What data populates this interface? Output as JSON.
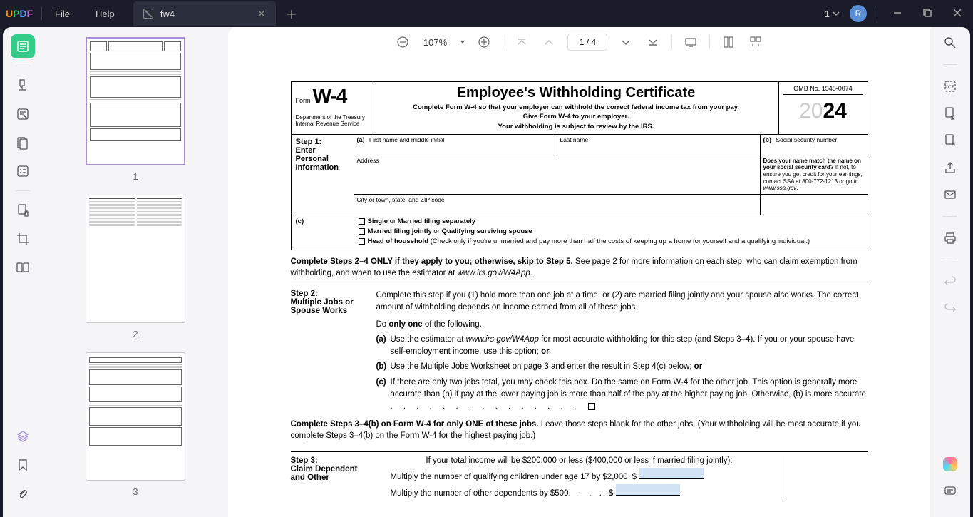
{
  "app": {
    "logo_chars": [
      "U",
      "P",
      "D",
      "F"
    ],
    "menu": {
      "file": "File",
      "help": "Help"
    },
    "tab_title": "fw4",
    "version": "1",
    "avatar_initial": "R"
  },
  "toolbar": {
    "zoom": "107%",
    "page_indicator": "1 / 4"
  },
  "thumbnails": {
    "pages": [
      "1",
      "2",
      "3"
    ]
  },
  "form": {
    "header": {
      "form_label": "Form",
      "form_code": "W-4",
      "dept1": "Department of the Treasury",
      "dept2": "Internal Revenue Service",
      "title": "Employee's Withholding Certificate",
      "sub1": "Complete Form W-4 so that your employer can withhold the correct federal income tax from your pay.",
      "sub2": "Give Form W-4 to your employer.",
      "sub3": "Your withholding is subject to review by the IRS.",
      "omb": "OMB No. 1545-0074",
      "year_prefix": "20",
      "year_suffix": "24"
    },
    "step1": {
      "label": "Step 1:",
      "title": "Enter Personal Information",
      "a_label": "(a)",
      "first_name": "First name and middle initial",
      "last_name": "Last name",
      "b_label": "(b)",
      "ssn": "Social security number",
      "address": "Address",
      "city": "City or town, state, and ZIP code",
      "name_match": "Does your name match the name on your social security card? If not, to ensure you get credit for your earnings, contact SSA at 800-772-1213 or go to www.ssa.gov.",
      "c_label": "(c)",
      "filing_single": "Single or Married filing separately",
      "filing_joint": "Married filing jointly or Qualifying surviving spouse",
      "filing_hoh": "Head of household (Check only if you're unmarried and pay more than half the costs of keeping up a home for yourself and a qualifying individual.)"
    },
    "instructions": {
      "complete24_bold": "Complete Steps 2–4 ONLY if they apply to you; otherwise, skip to Step 5.",
      "complete24_rest": " See page 2 for more information on each step, who can claim exemption from withholding, and when to use the estimator at ",
      "w4app": "www.irs.gov/W4App",
      "step34_bold": "Complete Steps 3–4(b) on Form W-4 for only ONE of these jobs.",
      "step34_rest": " Leave those steps blank for the other jobs. (Your withholding will be most accurate if you complete Steps 3–4(b) on the Form W-4 for the highest paying job.)"
    },
    "step2": {
      "label": "Step 2:",
      "title": "Multiple Jobs or Spouse Works",
      "intro": "Complete this step if you (1) hold more than one job at a time, or (2) are married filing jointly and your spouse also works. The correct amount of withholding depends on income earned from all of these jobs.",
      "do_only_pre": "Do ",
      "do_only_bold": "only one",
      "do_only_post": " of the following.",
      "a_pre": "Use the estimator at ",
      "a_link": "www.irs.gov/W4App",
      "a_post": " for most accurate withholding for this step (and Steps 3–4). If you or your spouse have self-employment income, use this option; ",
      "a_or": "or",
      "b_text": "Use the Multiple Jobs Worksheet on page 3 and enter the result in Step 4(c) below; ",
      "b_or": "or",
      "c_text": "If there are only two jobs total, you may check this box. Do the same on Form W-4 for the other job. This option is generally more accurate than (b) if pay at the lower paying job is more than half of the pay at the higher paying job. Otherwise, (b) is more accurate"
    },
    "step3": {
      "label": "Step 3:",
      "title": "Claim Dependent and Other",
      "intro": "If your total income will be $200,000 or less ($400,000 or less if married filing jointly):",
      "children": "Multiply the number of qualifying children under age 17 by $2,000",
      "other_dep": "Multiply the number of other dependents by $500",
      "dollar": "$"
    }
  }
}
